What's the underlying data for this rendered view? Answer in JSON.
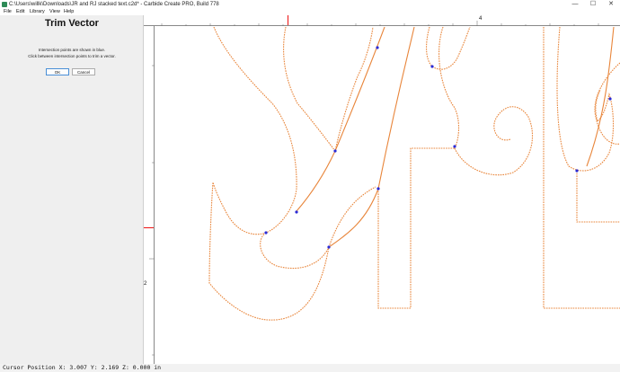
{
  "window": {
    "title": "C:\\Users\\willk\\Downloads\\JR and RJ stacked text.c2d* - Carbide Create PRO, Build 778",
    "minimize": "—",
    "maximize": "☐",
    "close": "✕"
  },
  "menu": {
    "items": [
      "File",
      "Edit",
      "Library",
      "View",
      "Help"
    ]
  },
  "panel": {
    "title": "Trim Vector",
    "line1": "Intersection points are shown in blue.",
    "line2": "Click between intersection points to trim a vector.",
    "ok_label": "OK",
    "cancel_label": "Cancel"
  },
  "rulers": {
    "top_label": "4",
    "left_label": "2"
  },
  "status": {
    "text": "Cursor Position X: 3.007 Y: 2.169 Z: 0.000 in"
  },
  "colors": {
    "vector": "#e8853a",
    "intersection": "#2b2bd6",
    "cursor_marker": "#e11111",
    "panel_bg": "#efefef"
  }
}
